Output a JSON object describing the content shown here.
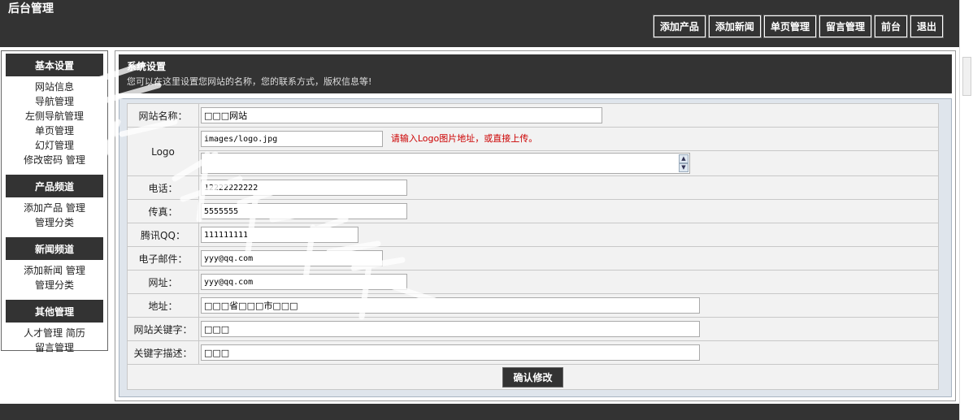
{
  "app_title": "后台管理",
  "top_nav": [
    "添加产品",
    "添加新闻",
    "单页管理",
    "留言管理",
    "前台",
    "退出"
  ],
  "sidebar": {
    "sections": [
      {
        "title": "基本设置",
        "links": [
          "网站信息",
          "导航管理",
          "左侧导航管理",
          "单页管理",
          "幻灯管理",
          "修改密码  管理"
        ]
      },
      {
        "title": "产品频道",
        "links": [
          "添加产品  管理",
          "管理分类"
        ]
      },
      {
        "title": "新闻频道",
        "links": [
          "添加新闻  管理",
          "管理分类"
        ]
      },
      {
        "title": "其他管理",
        "links": [
          "人才管理  简历",
          "留言管理"
        ]
      }
    ]
  },
  "main": {
    "title": "系统设置",
    "description": "您可以在这里设置您网站的名称，您的联系方式，版权信息等!"
  },
  "form": {
    "site_name_label": "网站名称：",
    "site_name_value": "□□□网站",
    "logo_label": "Logo",
    "logo_value": "images/logo.jpg",
    "logo_hint": "请输入Logo图片地址，或直接上传。",
    "phone_label": "电话：",
    "phone_value": "12222222222",
    "fax_label": "传真：",
    "fax_value": "5555555",
    "qq_label": "腾讯QQ：",
    "qq_value": "111111111",
    "email_label": "电子邮件：",
    "email_value": "yyy@qq.com",
    "website_label": "网址：",
    "website_value": "yyy@qq.com",
    "address_label": "地址：",
    "address_value": "□□□省□□□市□□□",
    "keywords_label": "网站关键字：",
    "keywords_value": "□□□",
    "description_label": "关键字描述：",
    "description_value": "□□□",
    "submit_label": "确认修改"
  },
  "colors": {
    "dark": "#333333",
    "hint_red": "#cc0000",
    "form_bg": "#f2f2f2",
    "frame_bg": "#dfe5ec"
  }
}
